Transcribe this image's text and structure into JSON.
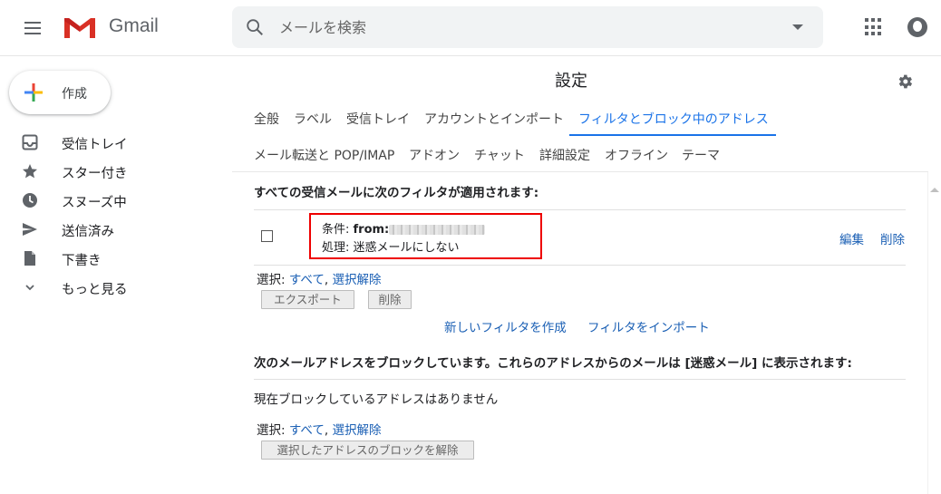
{
  "header": {
    "app_name": "Gmail",
    "search_placeholder": "メールを検索"
  },
  "sidebar": {
    "compose_label": "作成",
    "items": [
      {
        "label": "受信トレイ",
        "icon": "inbox-icon"
      },
      {
        "label": "スター付き",
        "icon": "star-icon"
      },
      {
        "label": "スヌーズ中",
        "icon": "clock-icon"
      },
      {
        "label": "送信済み",
        "icon": "send-icon"
      },
      {
        "label": "下書き",
        "icon": "draft-icon"
      },
      {
        "label": "もっと見る",
        "icon": "chevron-down-icon"
      }
    ]
  },
  "settings": {
    "title": "設定",
    "tabs_row1": [
      "全般",
      "ラベル",
      "受信トレイ",
      "アカウントとインポート",
      "フィルタとブロック中のアドレス"
    ],
    "tabs_row2": [
      "メール転送と POP/IMAP",
      "アドオン",
      "チャット",
      "詳細設定",
      "オフライン",
      "テーマ"
    ],
    "active_tab": "フィルタとブロック中のアドレス"
  },
  "filters": {
    "heading": "すべての受信メールに次のフィルタが適用されます:",
    "items": [
      {
        "condition_label": "条件: ",
        "condition_value": "from:",
        "action_label": "処理: ",
        "action_value": "迷惑メールにしない",
        "edit_label": "編集",
        "delete_label": "削除"
      }
    ],
    "select_label": "選択: ",
    "select_all": "すべて",
    "comma": ", ",
    "select_none": "選択解除",
    "export_button": "エクスポート",
    "delete_button": "削除",
    "create_filter_link": "新しいフィルタを作成",
    "import_filter_link": "フィルタをインポート"
  },
  "blocked": {
    "heading": "次のメールアドレスをブロックしています。これらのアドレスからのメールは [迷惑メール] に表示されます:",
    "empty_text": "現在ブロックしているアドレスはありません",
    "select_label": "選択: ",
    "select_all": "すべて",
    "comma": ", ",
    "select_none": "選択解除",
    "unblock_button": "選択したアドレスのブロックを解除"
  },
  "colors": {
    "accent": "#1a73e8",
    "link": "#1a5fb4",
    "highlight_border": "#ee0000"
  }
}
